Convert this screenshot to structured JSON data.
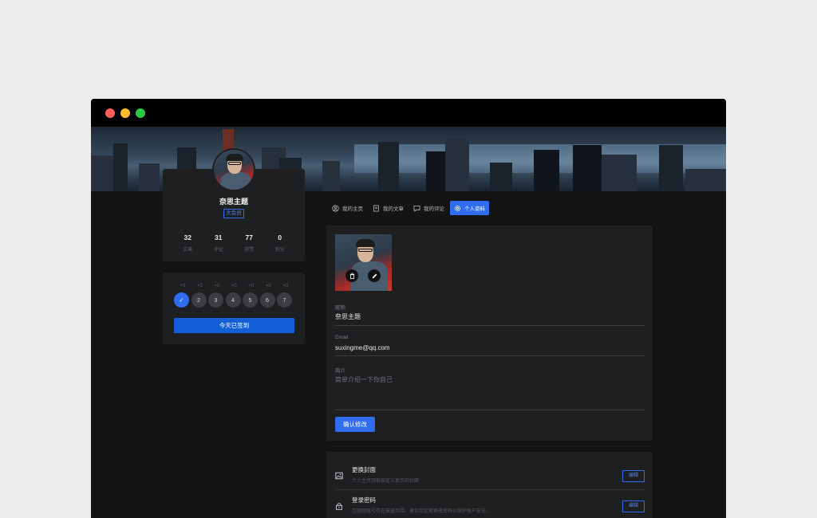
{
  "user": {
    "name": "奈思主题",
    "badge": "大会员",
    "stats": [
      {
        "num": "32",
        "label": "文章"
      },
      {
        "num": "31",
        "label": "评论"
      },
      {
        "num": "77",
        "label": "获赞"
      },
      {
        "num": "0",
        "label": "积分"
      }
    ]
  },
  "checkin": {
    "bonuses": [
      "+0",
      "+0",
      "+0",
      "+0",
      "+0",
      "+0",
      "+0"
    ],
    "days": [
      "✓",
      "2",
      "3",
      "4",
      "5",
      "6",
      "7"
    ],
    "button_label": "今天已签到"
  },
  "tabs": [
    {
      "label": "我的主页",
      "icon": "user-circle-icon"
    },
    {
      "label": "我的文章",
      "icon": "document-icon"
    },
    {
      "label": "我的评论",
      "icon": "comment-icon"
    },
    {
      "label": "个人资料",
      "icon": "gear-icon",
      "active": true
    }
  ],
  "form": {
    "delete_icon": "trash-icon",
    "edit_icon": "pencil-icon",
    "nickname_label": "昵称",
    "nickname_value": "奈思主题",
    "email_label": "Email",
    "email_value": "suxingme@qq.com",
    "bio_label": "简介",
    "bio_placeholder": "简单介绍一下你自己",
    "submit_label": "确认修改"
  },
  "settings": [
    {
      "icon": "image-icon",
      "title": "更换封面",
      "desc": "个人主页顶部自定义显示的封面",
      "button": "编辑"
    },
    {
      "icon": "lock-icon",
      "title": "登录密码",
      "desc": "互联网账号存在被盗风险，建议您定期更改密码以保护账户安全。",
      "button": "编辑"
    }
  ],
  "colors": {
    "accent": "#2f6cf0",
    "background": "#141415",
    "card": "#1e1f21"
  }
}
